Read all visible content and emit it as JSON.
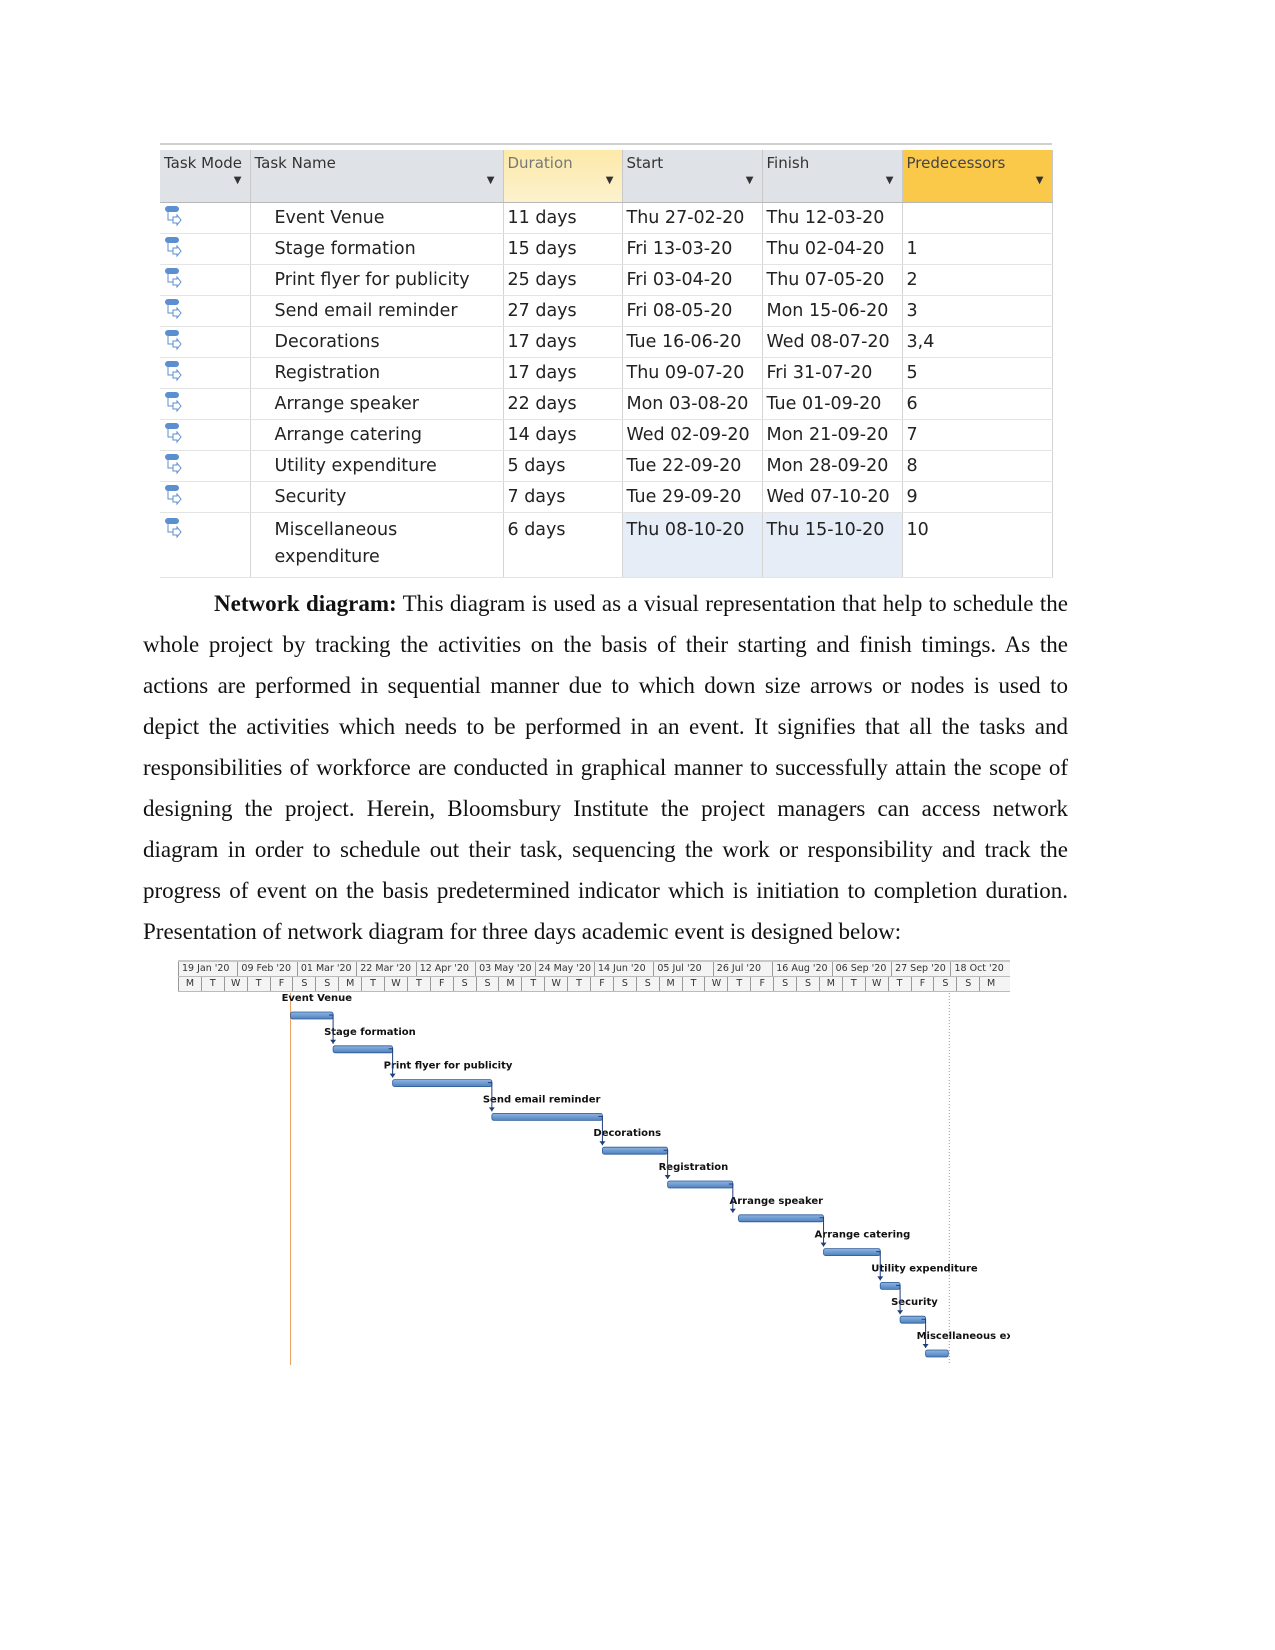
{
  "table": {
    "headers": {
      "mode": "Task Mode",
      "name": "Task Name",
      "duration": "Duration",
      "start": "Start",
      "finish": "Finish",
      "predecessors": "Predecessors"
    },
    "rows": [
      {
        "name": "Event Venue",
        "duration": "11 days",
        "start": "Thu 27-02-20",
        "finish": "Thu 12-03-20",
        "pred": ""
      },
      {
        "name": "Stage formation",
        "duration": "15 days",
        "start": "Fri 13-03-20",
        "finish": "Thu 02-04-20",
        "pred": "1"
      },
      {
        "name": "Print flyer for publicity",
        "duration": "25 days",
        "start": "Fri 03-04-20",
        "finish": "Thu 07-05-20",
        "pred": "2"
      },
      {
        "name": "Send email reminder",
        "duration": "27 days",
        "start": "Fri 08-05-20",
        "finish": "Mon 15-06-20",
        "pred": "3"
      },
      {
        "name": "Decorations",
        "duration": "17 days",
        "start": "Tue 16-06-20",
        "finish": "Wed 08-07-20",
        "pred": "3,4"
      },
      {
        "name": "Registration",
        "duration": "17 days",
        "start": "Thu 09-07-20",
        "finish": "Fri 31-07-20",
        "pred": "5"
      },
      {
        "name": "Arrange speaker",
        "duration": "22 days",
        "start": "Mon 03-08-20",
        "finish": "Tue 01-09-20",
        "pred": "6"
      },
      {
        "name": "Arrange catering",
        "duration": "14 days",
        "start": "Wed 02-09-20",
        "finish": "Mon 21-09-20",
        "pred": "7"
      },
      {
        "name": "Utility expenditure",
        "duration": "5 days",
        "start": "Tue 22-09-20",
        "finish": "Mon 28-09-20",
        "pred": "8"
      },
      {
        "name": "Security",
        "duration": "7 days",
        "start": "Tue 29-09-20",
        "finish": "Wed 07-10-20",
        "pred": "9"
      },
      {
        "name": "Miscellaneous expenditure",
        "duration": "6 days",
        "start": "Thu 08-10-20",
        "finish": "Thu 15-10-20",
        "pred": "10"
      }
    ]
  },
  "paragraph": {
    "heading": "Network diagram:",
    "text": " This diagram is used as a visual representation that help to schedule the whole project by tracking the activities on the basis of their starting and finish timings. As the actions are performed in sequential manner due to which down size arrows or nodes is used to depict the activities which needs to be performed in an event. It signifies that all the tasks and responsibilities of workforce are conducted in graphical manner to successfully attain the scope of designing the project. Herein, Bloomsbury Institute the project managers can access network diagram in order to schedule out their task, sequencing the work or responsibility and track the progress of event on the basis predetermined indicator which is initiation to completion duration. Presentation of network diagram for three days academic event is designed below:"
  },
  "gantt": {
    "major_ticks": [
      "19 Jan '20",
      "09 Feb '20",
      "01 Mar '20",
      "22 Mar '20",
      "12 Apr '20",
      "03 May '20",
      "24 May '20",
      "14 Jun '20",
      "05 Jul '20",
      "26 Jul '20",
      "16 Aug '20",
      "06 Sep '20",
      "27 Sep '20",
      "18 Oct '20"
    ],
    "minor_ticks": [
      "M",
      "T",
      "W",
      "T",
      "F",
      "S",
      "S",
      "M",
      "T",
      "W",
      "T",
      "F",
      "S",
      "S",
      "M",
      "T",
      "W",
      "T",
      "F",
      "S",
      "S",
      "M",
      "T",
      "W",
      "T",
      "F",
      "S",
      "S",
      "M",
      "T",
      "W",
      "T",
      "F",
      "S",
      "S",
      "M"
    ],
    "colors": {
      "bar": "#4f81bd",
      "bar_border": "#2c5a96",
      "today_line": "#e8a060",
      "link": "#1f3d7a"
    }
  }
}
